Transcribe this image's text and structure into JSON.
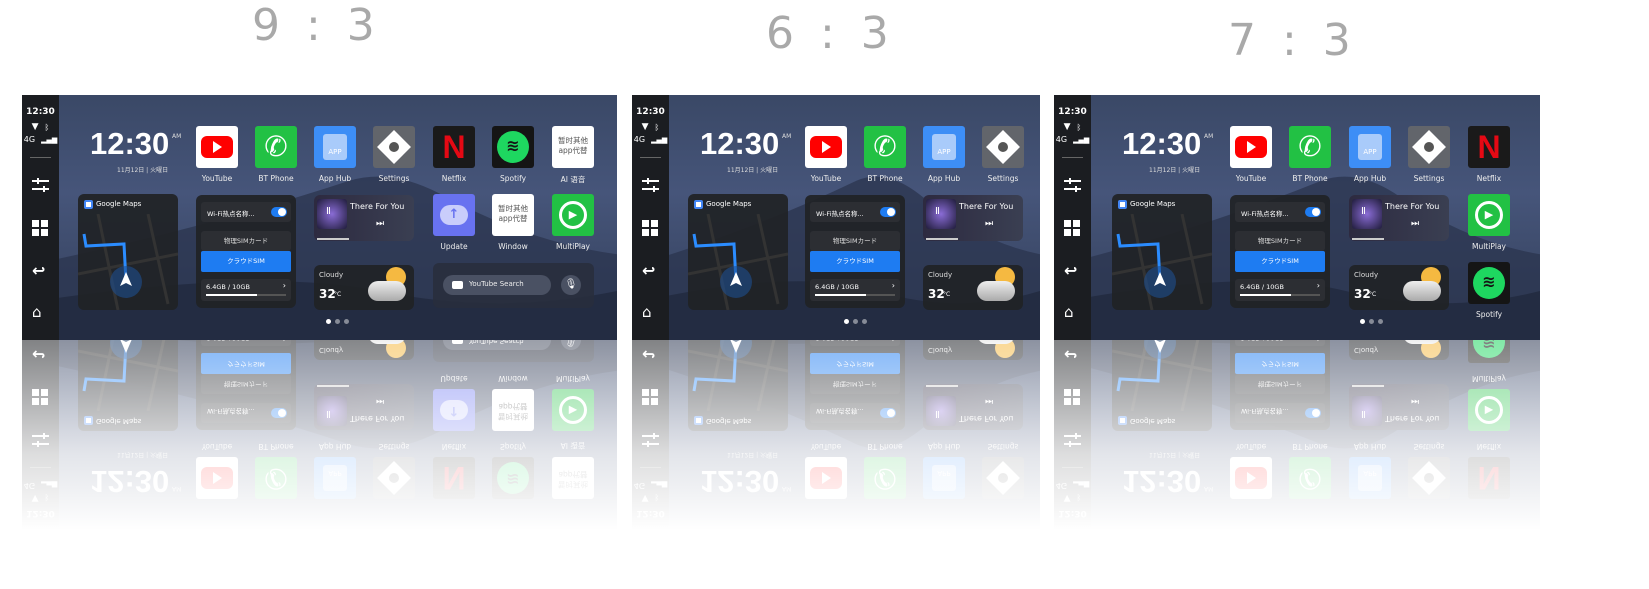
{
  "panels": [
    {
      "ratio_label": "9 : 3",
      "status": {
        "time": "12:30",
        "network": "4G"
      },
      "clock": {
        "time": "12:30",
        "ampm": "AM",
        "date": "11月12日 | 火曜日"
      },
      "apps": [
        {
          "label": "YouTube",
          "icon": "youtube-icon"
        },
        {
          "label": "BT Phone",
          "icon": "phone-icon"
        },
        {
          "label": "App Hub",
          "icon": "app-hub-icon"
        },
        {
          "label": "Settings",
          "icon": "settings-icon"
        },
        {
          "label": "Netflix",
          "icon": "netflix-icon"
        },
        {
          "label": "Spotify",
          "icon": "spotify-icon"
        },
        {
          "label": "AI 语音",
          "icon": "placeholder-app-icon",
          "icon_text": "暂时其他app代替"
        }
      ],
      "grid_apps": [
        {
          "label": "Update",
          "icon": "update-icon"
        },
        {
          "label": "Window",
          "icon": "placeholder-app-icon",
          "icon_text": "暂时其他app代替"
        },
        {
          "label": "MultiPlay",
          "icon": "multiplay-icon"
        }
      ],
      "search": {
        "label": "YouTube Search"
      },
      "pages": {
        "count": 3,
        "active": 1
      }
    },
    {
      "ratio_label": "6 : 3",
      "status": {
        "time": "12:30",
        "network": "4G"
      },
      "clock": {
        "time": "12:30",
        "ampm": "AM",
        "date": "11月12日 | 火曜日"
      },
      "apps": [
        {
          "label": "YouTube",
          "icon": "youtube-icon"
        },
        {
          "label": "BT Phone",
          "icon": "phone-icon"
        },
        {
          "label": "App Hub",
          "icon": "app-hub-icon"
        },
        {
          "label": "Settings",
          "icon": "settings-icon"
        }
      ],
      "grid_apps": [],
      "pages": {
        "count": 3,
        "active": 1
      }
    },
    {
      "ratio_label": "7 : 3",
      "status": {
        "time": "12:30",
        "network": "4G"
      },
      "clock": {
        "time": "12:30",
        "ampm": "AM",
        "date": "11月12日 | 火曜日"
      },
      "apps": [
        {
          "label": "YouTube",
          "icon": "youtube-icon"
        },
        {
          "label": "BT Phone",
          "icon": "phone-icon"
        },
        {
          "label": "App Hub",
          "icon": "app-hub-icon"
        },
        {
          "label": "Settings",
          "icon": "settings-icon"
        },
        {
          "label": "Netflix",
          "icon": "netflix-icon"
        }
      ],
      "grid_apps": [
        {
          "label": "MultiPlay",
          "icon": "multiplay-icon"
        },
        {
          "label": "Spotify",
          "icon": "spotify-icon"
        }
      ],
      "pages": {
        "count": 3,
        "active": 1
      }
    }
  ],
  "widgets": {
    "maps": {
      "title": "Google Maps"
    },
    "hotspot": {
      "wifi_label": "Wi-Fi热点名称...",
      "wifi_on": true,
      "sim_physical": "物理SIMカード",
      "sim_cloud": "クラウドSIM",
      "usage": "6.4GB / 10GB",
      "usage_fraction": 0.64
    },
    "music": {
      "title": "There For You"
    },
    "weather": {
      "condition": "Cloudy",
      "temp": "32",
      "unit": "°C"
    }
  },
  "colors": {
    "accent": "#1e7cf2",
    "youtube": "#ff0000",
    "phone": "#22c144",
    "spotify": "#1ed760",
    "netflix": "#e50914"
  }
}
